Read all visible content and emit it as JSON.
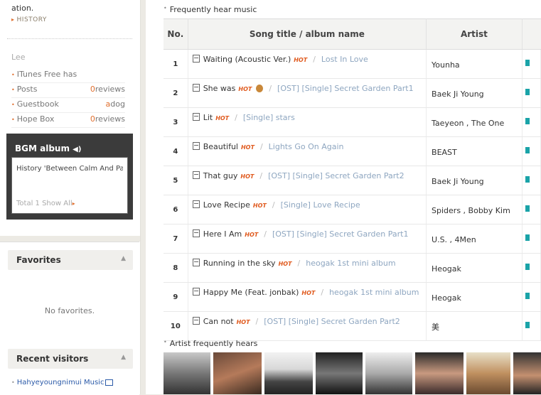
{
  "sidebar": {
    "partial_text": "ation.",
    "history_label": "HISTORY",
    "owner_name": "Lee",
    "stats": [
      {
        "label": "ITunes Free has",
        "value": "",
        "highlight": ""
      },
      {
        "label": "Posts",
        "value": "reviews",
        "highlight": "0"
      },
      {
        "label": "Guestbook",
        "value": "dog",
        "highlight": "a"
      },
      {
        "label": "Hope Box",
        "value": "reviews",
        "highlight": "0"
      }
    ],
    "bgm": {
      "title": "BGM album",
      "song": "History 'Between Calm And Pa",
      "total": "Total 1 Show All"
    },
    "favorites": {
      "title": "Favorites",
      "empty": "No favorites."
    },
    "recent_visitors": {
      "title": "Recent visitors",
      "first_visitor": "Hahyeyoungnimui Music"
    }
  },
  "main": {
    "music_section_title": "Frequently hear music",
    "columns": [
      "No.",
      "Song title / album name",
      "Artist"
    ],
    "hot_label": "HOT",
    "songs": [
      {
        "no": "1",
        "title": "Waiting (Acoustic Ver.)",
        "album": "Lost In Love",
        "artist": "Younha"
      },
      {
        "no": "2",
        "title": "She was",
        "album": "[OST] [Single] Secret Garden Part1",
        "artist": "Baek Ji Young"
      },
      {
        "no": "3",
        "title": "Lit",
        "album": "[Single] stars",
        "artist": "Taeyeon , The One"
      },
      {
        "no": "4",
        "title": "Beautiful",
        "album": "Lights Go On Again",
        "artist": "BEAST"
      },
      {
        "no": "5",
        "title": "That guy",
        "album": "[OST] [Single] Secret Garden Part2",
        "artist": "Baek Ji Young"
      },
      {
        "no": "6",
        "title": "Love Recipe",
        "album": "[Single] Love Recipe",
        "artist": "Spiders , Bobby Kim"
      },
      {
        "no": "7",
        "title": "Here I Am",
        "album": "[OST] [Single] Secret Garden Part1",
        "artist": "U.S. , 4Men"
      },
      {
        "no": "8",
        "title": "Running in the sky",
        "album": "heogak 1st mini album",
        "artist": "Heogak"
      },
      {
        "no": "9",
        "title": "Happy Me (Feat. jonbak)",
        "album": "heogak 1st mini album",
        "artist": "Heogak"
      },
      {
        "no": "10",
        "title": "Can not",
        "album": "[OST] [Single] Secret Garden Part2",
        "artist": "美"
      }
    ],
    "artist_section_title": "Artist frequently hears"
  },
  "colors": {
    "accent": "#e05a1e",
    "album_link": "#8ea6c0",
    "bgm_bg": "#3b3b3b",
    "hot": "#e05a1e"
  }
}
